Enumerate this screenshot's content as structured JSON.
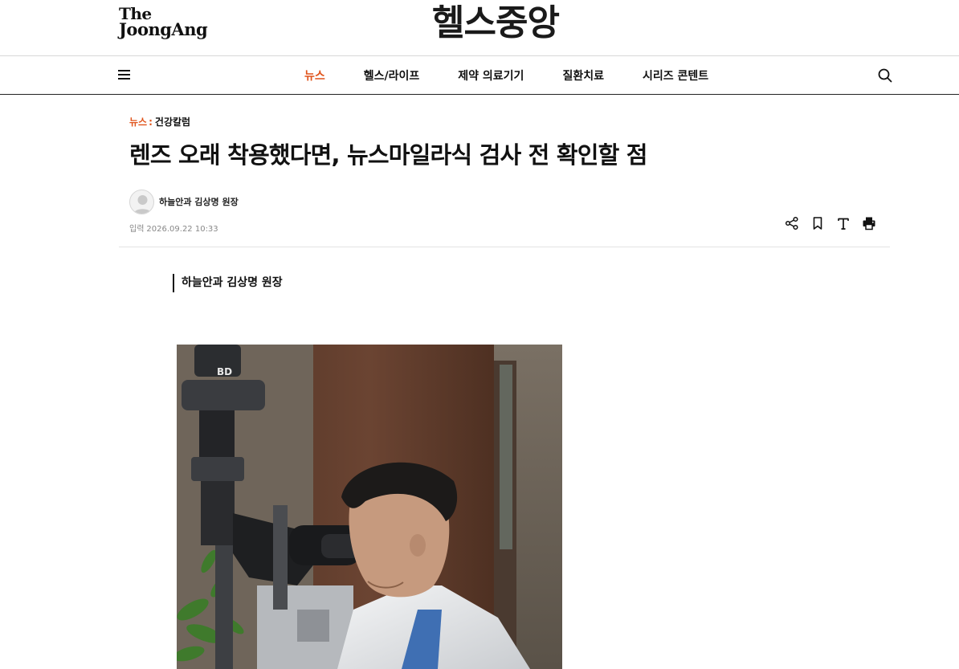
{
  "header": {
    "logo_joongang_line1": "The",
    "logo_joongang_line2": "JoongAng",
    "logo_health": "헬스중앙"
  },
  "nav": {
    "items": [
      {
        "label": "뉴스",
        "active": true
      },
      {
        "label": "헬스/라이프",
        "active": false
      },
      {
        "label": "제약 의료기기",
        "active": false
      },
      {
        "label": "질환치료",
        "active": false
      },
      {
        "label": "시리즈 콘텐트",
        "active": false
      }
    ],
    "icons": [
      "menu-icon",
      "search-icon"
    ]
  },
  "article": {
    "breadcrumb": {
      "section": "뉴스",
      "separator": ":",
      "subsection": "건강칼럼"
    },
    "title": "렌즈 오래 착용했다면, 뉴스마일라식 검사 전 확인할 점",
    "author": "하늘안과 김상명 원장",
    "date_label": "입력",
    "date": "2026.09.22 10:33",
    "tools": [
      "share-icon",
      "bookmark-icon",
      "font-size-icon",
      "print-icon"
    ],
    "summary": "하늘안과 김상명 원장"
  },
  "colors": {
    "accent": "#e0541b",
    "text": "#111111",
    "muted": "#888888"
  }
}
